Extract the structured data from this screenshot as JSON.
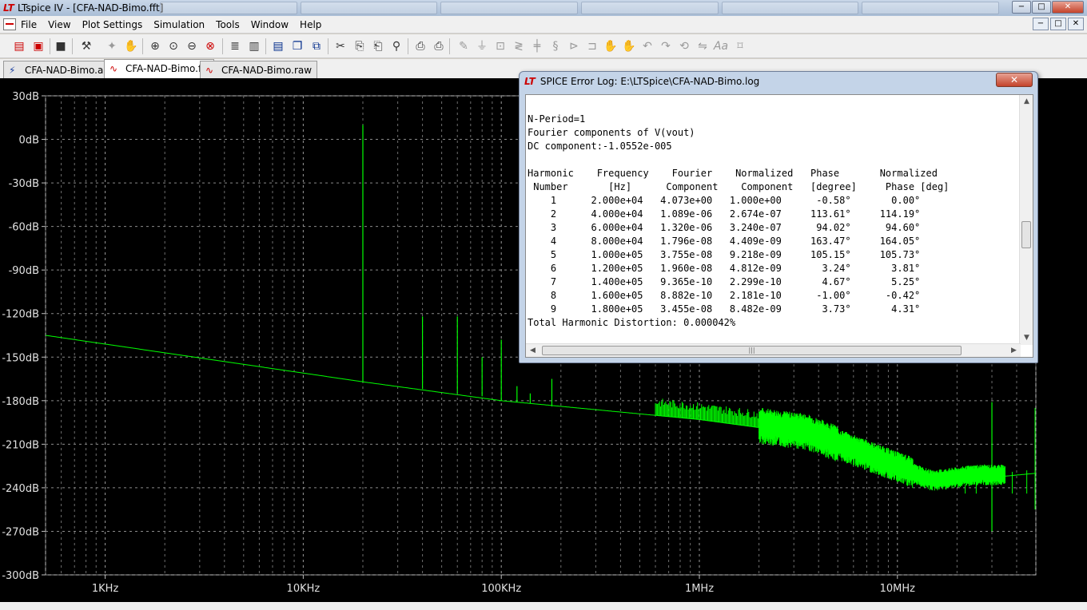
{
  "window": {
    "title": "LTspice IV - [CFA-NAD-Bimo.fft]",
    "app_icon": "ltspice-logo-icon",
    "minimize": "−",
    "restore": "□",
    "close": "✕"
  },
  "menu": {
    "items": [
      "File",
      "View",
      "Plot Settings",
      "Simulation",
      "Tools",
      "Window",
      "Help"
    ],
    "mdi_minimize": "−",
    "mdi_restore": "□",
    "mdi_close": "✕"
  },
  "toolbar": {
    "icons": [
      "new-schematic-icon",
      "open-icon",
      "save-icon",
      "control-panel-icon",
      "run-icon",
      "pan-icon",
      "zoom-in-icon",
      "zoom-area-icon",
      "zoom-out-icon",
      "zoom-cancel-icon",
      "autorange-icon",
      "tile-vertical-icon",
      "tile-horizontal-icon",
      "cascade-icon",
      "cut-icon",
      "copy-icon",
      "paste-icon",
      "find-icon",
      "print-setup-icon",
      "print-icon",
      "wire-icon",
      "ground-icon",
      "label-icon",
      "resistor-icon",
      "capacitor-icon",
      "inductor-icon",
      "diode-icon",
      "component-icon",
      "move-icon",
      "drag-icon",
      "undo-icon",
      "redo-icon",
      "rotate-icon",
      "mirror-icon",
      "text-icon",
      "spice-directive-icon"
    ]
  },
  "tabs": [
    {
      "label": "CFA-NAD-Bimo.asc",
      "icon": "schematic-icon",
      "active": false
    },
    {
      "label": "CFA-NAD-Bimo.fft",
      "icon": "waveform-icon",
      "active": true
    },
    {
      "label": "CFA-NAD-Bimo.raw",
      "icon": "waveform-icon",
      "active": false
    }
  ],
  "chart_data": {
    "type": "line",
    "xscale": "log",
    "xlim": [
      500,
      50000000
    ],
    "ylim": [
      -300,
      30
    ],
    "grid": true,
    "y_ticks": [
      "30dB",
      "0dB",
      "-30dB",
      "-60dB",
      "-90dB",
      "-120dB",
      "-150dB",
      "-180dB",
      "-210dB",
      "-240dB",
      "-270dB",
      "-300dB"
    ],
    "y_tick_values": [
      30,
      0,
      -30,
      -60,
      -90,
      -120,
      -150,
      -180,
      -210,
      -240,
      -270,
      -300
    ],
    "x_ticks": [
      "1KHz",
      "10KHz",
      "100KHz",
      "1MHz",
      "10MHz"
    ],
    "x_tick_values": [
      1000,
      10000,
      100000,
      1000000,
      10000000
    ],
    "line_color": "#00ff00",
    "background": "#000000",
    "noise_floor": {
      "x": [
        500,
        20000,
        100000,
        1000000,
        3500000,
        8000000,
        15000000,
        25000000,
        35000000,
        50000000
      ],
      "y": [
        -135,
        -167,
        -180,
        -193,
        -203,
        -222,
        -236,
        -232,
        -232,
        -230
      ]
    },
    "spikes": [
      {
        "x": 20000,
        "y": 10,
        "base": -167
      },
      {
        "x": 40000,
        "y": -122,
        "base": -172
      },
      {
        "x": 60000,
        "y": -122,
        "base": -175
      },
      {
        "x": 80000,
        "y": -150,
        "base": -177
      },
      {
        "x": 100000,
        "y": -138,
        "base": -180
      },
      {
        "x": 120000,
        "y": -170,
        "base": -181
      },
      {
        "x": 140000,
        "y": -175,
        "base": -182
      },
      {
        "x": 180000,
        "y": -165,
        "base": -184
      },
      {
        "x": 30000000,
        "y": -181,
        "base": -270
      }
    ]
  },
  "log": {
    "title": "SPICE Error Log: E:\\LTSpice\\CFA-NAD-Bimo.log",
    "icon": "ltspice-logo-icon",
    "close": "✕",
    "lines": [
      "N-Period=1",
      "Fourier components of V(vout)",
      "DC component:-1.0552e-005",
      "",
      "Harmonic    Frequency    Fourier    Normalized   Phase       Normalized",
      " Number       [Hz]      Component    Component   [degree]     Phase [deg]",
      "    1      2.000e+04   4.073e+00   1.000e+00      -0.58°       0.00°",
      "    2      4.000e+04   1.089e-06   2.674e-07     113.61°     114.19°",
      "    3      6.000e+04   1.320e-06   3.240e-07      94.02°      94.60°",
      "    4      8.000e+04   1.796e-08   4.409e-09     163.47°     164.05°",
      "    5      1.000e+05   3.755e-08   9.218e-09     105.15°     105.73°",
      "    6      1.200e+05   1.960e-08   4.812e-09       3.24°       3.81°",
      "    7      1.400e+05   9.365e-10   2.299e-10       4.67°       5.25°",
      "    8      1.600e+05   8.882e-10   2.181e-10      -1.00°      -0.42°",
      "    9      1.800e+05   3.455e-08   8.482e-09       3.73°       4.31°",
      "Total Harmonic Distortion: 0.000042%"
    ]
  }
}
